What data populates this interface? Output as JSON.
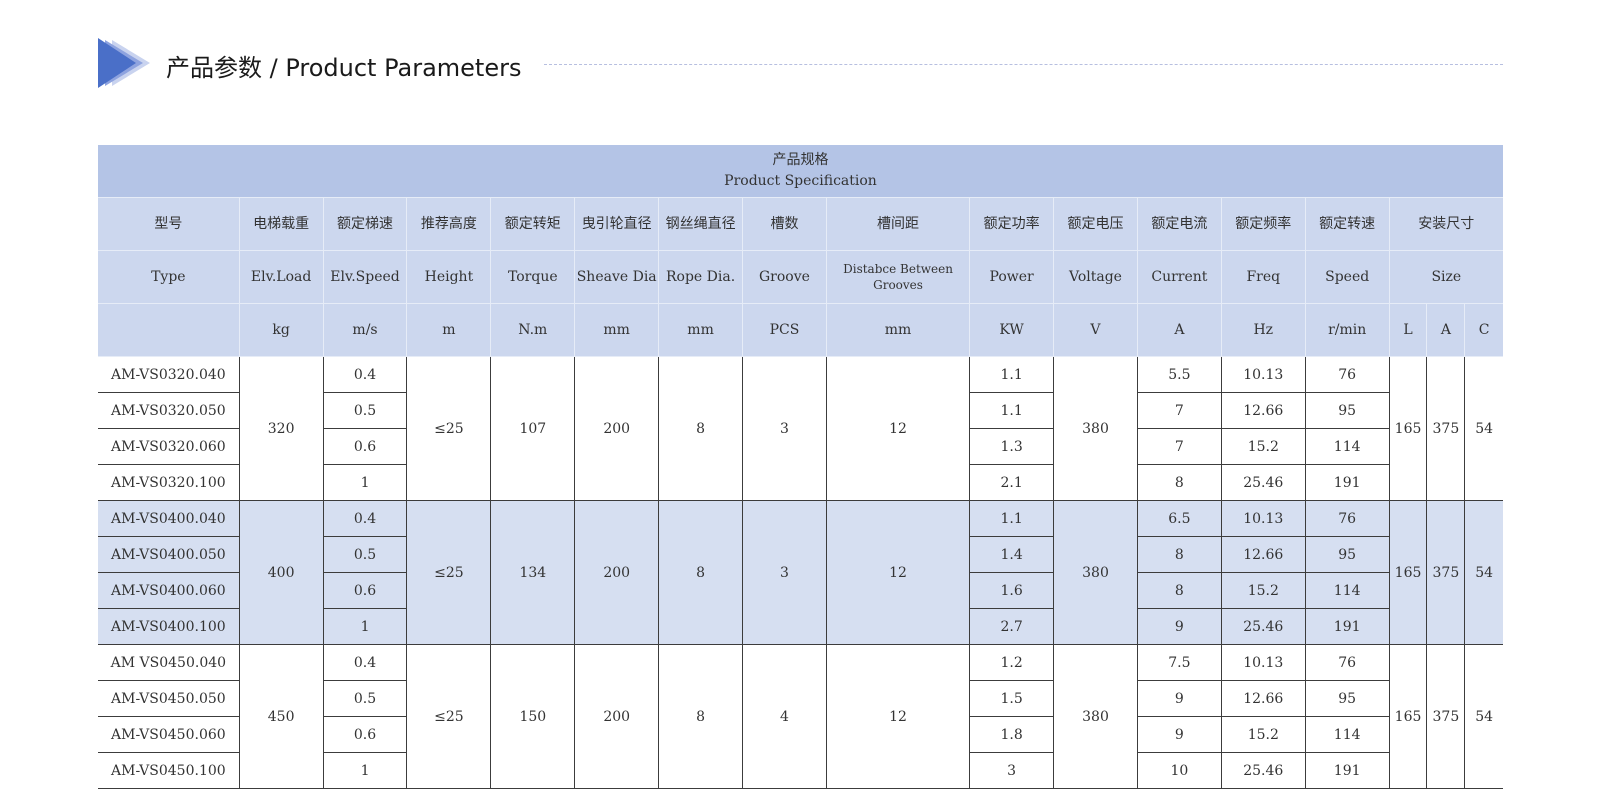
{
  "heading": {
    "title": "产品参数 / Product Parameters",
    "accent_color": "#4a6fc8"
  },
  "table": {
    "title_cn": "产品规格",
    "title_en": "Product Specification",
    "headers_cn": [
      "型号",
      "电梯载重",
      "额定梯速",
      "推荐高度",
      "额定转矩",
      "曳引轮直径",
      "钢丝绳直径",
      "槽数",
      "槽间距",
      "额定功率",
      "额定电压",
      "额定电流",
      "额定频率",
      "额定转速",
      "安装尺寸"
    ],
    "headers_en": [
      "Type",
      "Elv.Load",
      "Elv.Speed",
      "Height",
      "Torque",
      "Sheave Dia",
      "Rope Dia.",
      "Groove",
      "Distabce Between Grooves",
      "Power",
      "Voltage",
      "Current",
      "Freq",
      "Speed",
      "Size"
    ],
    "units": [
      "",
      "kg",
      "m/s",
      "m",
      "N.m",
      "mm",
      "mm",
      "PCS",
      "mm",
      "KW",
      "V",
      "A",
      "Hz",
      "r/min",
      "L",
      "A",
      "C"
    ],
    "groups": [
      {
        "load": "320",
        "height": "≤25",
        "torque": "107",
        "sheave": "200",
        "rope": "8",
        "groove": "3",
        "spacing": "12",
        "voltage": "380",
        "size_l": "165",
        "size_a": "375",
        "size_c": "54",
        "rows": [
          {
            "type": "AM-VS0320.040",
            "speed": "0.4",
            "power": "1.1",
            "current": "5.5",
            "freq": "10.13",
            "rpm": "76"
          },
          {
            "type": "AM-VS0320.050",
            "speed": "0.5",
            "power": "1.1",
            "current": "7",
            "freq": "12.66",
            "rpm": "95"
          },
          {
            "type": "AM-VS0320.060",
            "speed": "0.6",
            "power": "1.3",
            "current": "7",
            "freq": "15.2",
            "rpm": "114"
          },
          {
            "type": "AM-VS0320.100",
            "speed": "1",
            "power": "2.1",
            "current": "8",
            "freq": "25.46",
            "rpm": "191"
          }
        ]
      },
      {
        "load": "400",
        "height": "≤25",
        "torque": "134",
        "sheave": "200",
        "rope": "8",
        "groove": "3",
        "spacing": "12",
        "voltage": "380",
        "size_l": "165",
        "size_a": "375",
        "size_c": "54",
        "rows": [
          {
            "type": "AM-VS0400.040",
            "speed": "0.4",
            "power": "1.1",
            "current": "6.5",
            "freq": "10.13",
            "rpm": "76"
          },
          {
            "type": "AM-VS0400.050",
            "speed": "0.5",
            "power": "1.4",
            "current": "8",
            "freq": "12.66",
            "rpm": "95"
          },
          {
            "type": "AM-VS0400.060",
            "speed": "0.6",
            "power": "1.6",
            "current": "8",
            "freq": "15.2",
            "rpm": "114"
          },
          {
            "type": "AM-VS0400.100",
            "speed": "1",
            "power": "2.7",
            "current": "9",
            "freq": "25.46",
            "rpm": "191"
          }
        ]
      },
      {
        "load": "450",
        "height": "≤25",
        "torque": "150",
        "sheave": "200",
        "rope": "8",
        "groove": "4",
        "spacing": "12",
        "voltage": "380",
        "size_l": "165",
        "size_a": "375",
        "size_c": "54",
        "rows": [
          {
            "type": "AM VS0450.040",
            "speed": "0.4",
            "power": "1.2",
            "current": "7.5",
            "freq": "10.13",
            "rpm": "76"
          },
          {
            "type": "AM-VS0450.050",
            "speed": "0.5",
            "power": "1.5",
            "current": "9",
            "freq": "12.66",
            "rpm": "95"
          },
          {
            "type": "AM-VS0450.060",
            "speed": "0.6",
            "power": "1.8",
            "current": "9",
            "freq": "15.2",
            "rpm": "114"
          },
          {
            "type": "AM-VS0450.100",
            "speed": "1",
            "power": "3",
            "current": "10",
            "freq": "25.46",
            "rpm": "191"
          }
        ]
      }
    ]
  }
}
